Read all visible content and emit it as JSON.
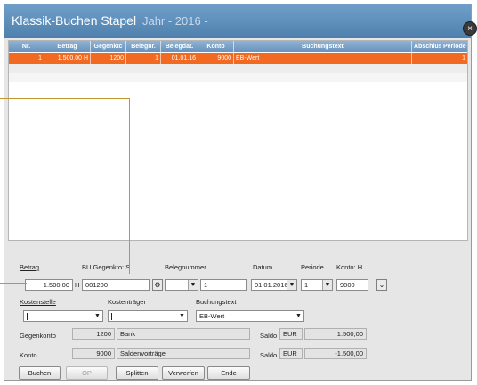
{
  "window": {
    "title": "Klassik-Buchen Stapel",
    "subtitle": "Jahr - 2016 -",
    "close_label": "×"
  },
  "grid": {
    "columns": [
      "Nr.",
      "Betrag",
      "Gegenktc",
      "Belegnr.",
      "Belegdat.",
      "Konto",
      "Buchungstext",
      "Abschluss",
      "Periode"
    ],
    "rows": [
      {
        "nr": "1",
        "betrag": "1.500,00 H",
        "gegenkonto": "1200",
        "belegnr": "1",
        "belegdat": "01.01.16",
        "konto": "9000",
        "text": "EB-Wert",
        "abschluss": "",
        "periode": "1"
      }
    ],
    "selected_color": "#f26a22"
  },
  "form": {
    "betrag_label": "Betrag",
    "betrag_value": "1.500,00",
    "betrag_sh": "H",
    "gegenkonto_label": "BU Gegenkto: S",
    "gegenkonto_value": "001200",
    "belegnummer_label": "Belegnummer",
    "belegnummer_value": "1",
    "datum_label": "Datum",
    "datum_value": "01.01.2016",
    "periode_label": "Periode",
    "periode_value": "1",
    "konto_label": "Konto: H",
    "konto_value": "9000",
    "kostenstelle_label": "Kostenstelle",
    "kostentraeger_label": "Kostenträger",
    "buchungstext_label": "Buchungstext",
    "buchungstext_value": "EB-Wert",
    "gegenkonto_info_label": "Gegenkonto",
    "gegenkonto_info_nr": "1200",
    "gegenkonto_info_name": "Bank",
    "konto_info_label": "Konto",
    "konto_info_nr": "9000",
    "konto_info_name": "Saldenvorträge",
    "saldo_label_1": "Saldo",
    "saldo_cur_1": "EUR",
    "saldo_value_1": "1.500,00",
    "saldo_label_2": "Saldo",
    "saldo_cur_2": "EUR",
    "saldo_value_2": "-1.500,00",
    "dropdown_arrow": "▼",
    "check_arrow": "⌄"
  },
  "buttons": {
    "buchen": "Buchen",
    "op": "OP",
    "splitten": "Splitten",
    "verwerfen": "Verwerfen",
    "ende": "Ende"
  }
}
